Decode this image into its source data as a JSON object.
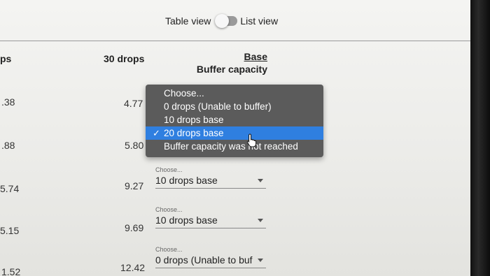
{
  "toggle": {
    "table_label": "Table view",
    "list_label": "List view"
  },
  "header": {
    "col_partial": "ps",
    "col_30": "30 drops",
    "base_link": "Base",
    "base_title": "Buffer capacity"
  },
  "left_values": [
    ".38",
    ".88",
    "5.74",
    "5.15",
    "1.52"
  ],
  "drops30_values": [
    "4.77",
    "5.80",
    "9.27",
    "9.69",
    "12.42"
  ],
  "dropdowns": [
    {
      "label": "Choose...",
      "value": "10 drops base"
    },
    {
      "label": "Choose...",
      "value": "10 drops base"
    },
    {
      "label": "Choose...",
      "value": "0 drops (Unable to buf"
    }
  ],
  "menu": {
    "options": [
      "Choose...",
      "0 drops (Unable to buffer)",
      "10 drops base",
      "20 drops base",
      "Buffer capacity was not reached"
    ],
    "selected_index": 3,
    "check_mark": "✓"
  }
}
